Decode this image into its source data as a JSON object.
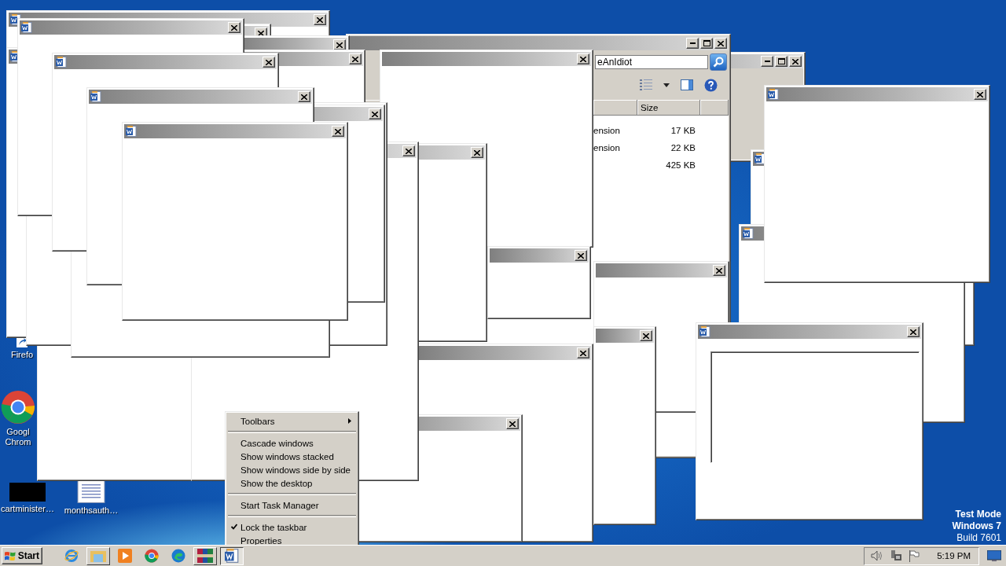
{
  "explorer_window": {
    "search_value": "eAnIdiot",
    "columns": [
      "Size"
    ],
    "rows": [
      {
        "column_2": "ension",
        "size": "17 KB"
      },
      {
        "column_2": "ension",
        "size": "22 KB"
      },
      {
        "column_2": "",
        "size": "425 KB"
      }
    ]
  },
  "popup_windows": [
    {
      "kind": "frame"
    },
    {
      "kind": "plain"
    },
    {
      "kind": "document"
    },
    {
      "kind": "document"
    },
    {
      "kind": "plain"
    },
    {
      "kind": "plain"
    },
    {
      "kind": "plain"
    },
    {
      "kind": "plain"
    },
    {
      "kind": "plain"
    },
    {
      "kind": "plain"
    },
    {
      "kind": "document"
    },
    {
      "kind": "document"
    },
    {
      "kind": "plain"
    },
    {
      "kind": "plain"
    },
    {
      "kind": "plain"
    },
    {
      "kind": "plain"
    },
    {
      "kind": "plain"
    },
    {
      "kind": "plain"
    },
    {
      "kind": "plain"
    },
    {
      "kind": "plain"
    },
    {
      "kind": "document"
    },
    {
      "kind": "document"
    },
    {
      "kind": "document"
    },
    {
      "kind": "document"
    },
    {
      "kind": "document"
    },
    {
      "kind": "document_panel"
    }
  ],
  "desktop_icons": [
    {
      "kind": "firefox",
      "lines": [
        "Firefo"
      ]
    },
    {
      "kind": "chrome",
      "lines": [
        "Googl",
        "Chrom"
      ]
    },
    {
      "kind": "black",
      "lines": [
        "cartminister…"
      ]
    },
    {
      "kind": "document",
      "lines": [
        "monthsauth…"
      ]
    }
  ],
  "context_menu": [
    {
      "kind": "item",
      "label": "Toolbars",
      "submenu": true,
      "checked": false
    },
    {
      "kind": "separator"
    },
    {
      "kind": "item",
      "label": "Cascade windows",
      "submenu": false,
      "checked": false
    },
    {
      "kind": "item",
      "label": "Show windows stacked",
      "submenu": false,
      "checked": false
    },
    {
      "kind": "item",
      "label": "Show windows side by side",
      "submenu": false,
      "checked": false
    },
    {
      "kind": "item",
      "label": "Show the desktop",
      "submenu": false,
      "checked": false
    },
    {
      "kind": "separator"
    },
    {
      "kind": "item",
      "label": "Start Task Manager",
      "submenu": false,
      "checked": false
    },
    {
      "kind": "separator"
    },
    {
      "kind": "item",
      "label": "Lock the taskbar",
      "submenu": false,
      "checked": true
    },
    {
      "kind": "item",
      "label": "Properties",
      "submenu": false,
      "checked": false
    }
  ],
  "watermark": [
    "Test Mode",
    "Windows 7",
    "Build 7601"
  ],
  "taskbar": {
    "start_label": "Start",
    "apps": [
      {
        "kind": "ie",
        "running": false,
        "selected": false
      },
      {
        "kind": "explorer",
        "running": true,
        "selected": false
      },
      {
        "kind": "media",
        "running": false,
        "selected": false
      },
      {
        "kind": "chrome",
        "running": false,
        "selected": false
      },
      {
        "kind": "edge",
        "running": false,
        "selected": false
      },
      {
        "kind": "winrar",
        "running": true,
        "selected": false
      },
      {
        "kind": "word",
        "running": true,
        "selected": true
      }
    ],
    "time": "5:19 PM"
  }
}
